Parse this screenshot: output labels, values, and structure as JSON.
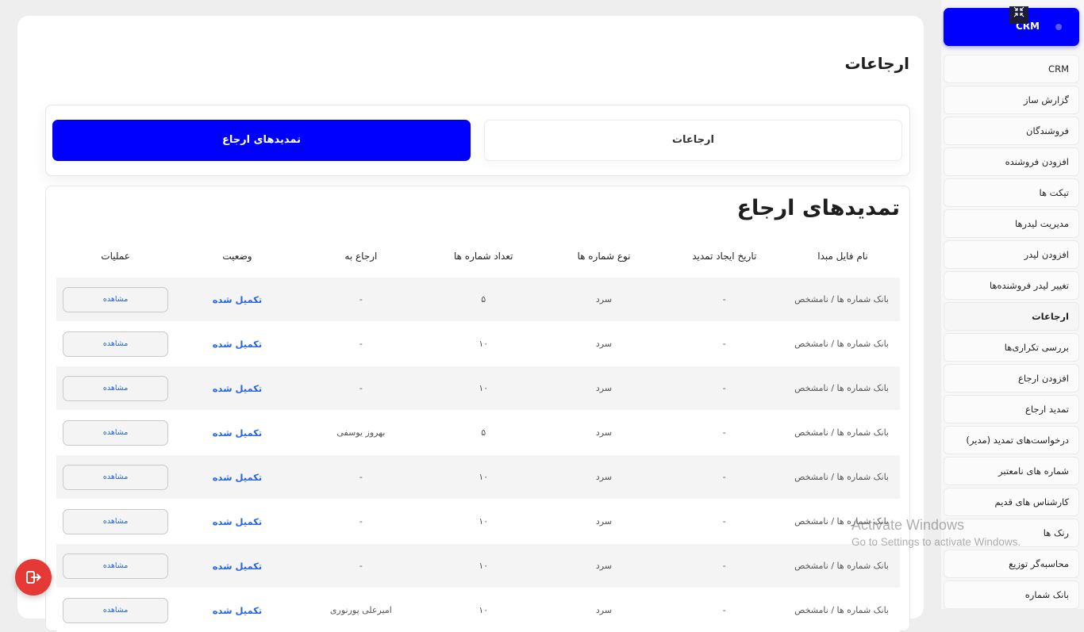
{
  "sidebar": {
    "header_label": "CRM",
    "items": [
      {
        "label": "CRM",
        "active": false
      },
      {
        "label": "گزارش ساز",
        "active": false
      },
      {
        "label": "فروشندگان",
        "active": false
      },
      {
        "label": "افزودن فروشنده",
        "active": false
      },
      {
        "label": "تیکت ها",
        "active": false
      },
      {
        "label": "مدیریت لیدرها",
        "active": false
      },
      {
        "label": "افزودن لیدر",
        "active": false
      },
      {
        "label": "تغییر لیدر فروشنده‌ها",
        "active": false
      },
      {
        "label": "ارجاعات",
        "active": true
      },
      {
        "label": "بررسی تکراری‌ها",
        "active": false
      },
      {
        "label": "افزودن ارجاع",
        "active": false
      },
      {
        "label": "تمدید ارجاع",
        "active": false
      },
      {
        "label": "درخواست‌های تمدید (مدیر)",
        "active": false
      },
      {
        "label": "شماره های نامعتبر",
        "active": false
      },
      {
        "label": "کارشناس های قدیم",
        "active": false
      },
      {
        "label": "رنک ها",
        "active": false
      },
      {
        "label": "محاسبه‌گر توزیع",
        "active": false
      },
      {
        "label": "بانک شماره",
        "active": false
      }
    ]
  },
  "page": {
    "title": "ارجاعات",
    "tabs": {
      "referrals": "ارجاعات",
      "extensions": "تمدیدهای ارجاع"
    },
    "section_title": "تمدیدهای ارجاع"
  },
  "table": {
    "headers": [
      "نام فایل مبدا",
      "تاریخ ایجاد تمدید",
      "نوع شماره ها",
      "تعداد شماره ها",
      "ارجاع به",
      "وضعیت",
      "عملیات"
    ],
    "rows": [
      {
        "file": "بانک شماره ها / نامشخص",
        "date": "-",
        "type": "سرد",
        "count": "۵",
        "referred_to": "-",
        "status": "تکمیل شده",
        "action": "مشاهده"
      },
      {
        "file": "بانک شماره ها / نامشخص",
        "date": "-",
        "type": "سرد",
        "count": "۱۰",
        "referred_to": "-",
        "status": "تکمیل شده",
        "action": "مشاهده"
      },
      {
        "file": "بانک شماره ها / نامشخص",
        "date": "-",
        "type": "سرد",
        "count": "۱۰",
        "referred_to": "-",
        "status": "تکمیل شده",
        "action": "مشاهده"
      },
      {
        "file": "بانک شماره ها / نامشخص",
        "date": "-",
        "type": "سرد",
        "count": "۵",
        "referred_to": "بهروز یوسفی",
        "status": "تکمیل شده",
        "action": "مشاهده"
      },
      {
        "file": "بانک شماره ها / نامشخص",
        "date": "-",
        "type": "سرد",
        "count": "۱۰",
        "referred_to": "-",
        "status": "تکمیل شده",
        "action": "مشاهده"
      },
      {
        "file": "بانک شماره ها / نامشخص",
        "date": "-",
        "type": "سرد",
        "count": "۱۰",
        "referred_to": "-",
        "status": "تکمیل شده",
        "action": "مشاهده"
      },
      {
        "file": "بانک شماره ها / نامشخص",
        "date": "-",
        "type": "سرد",
        "count": "۱۰",
        "referred_to": "-",
        "status": "تکمیل شده",
        "action": "مشاهده"
      },
      {
        "file": "بانک شماره ها / نامشخص",
        "date": "-",
        "type": "سرد",
        "count": "۱۰",
        "referred_to": "امیرعلی پورنوری",
        "status": "تکمیل شده",
        "action": "مشاهده"
      }
    ]
  },
  "icons": {
    "collapse": "collapse-arrows-icon",
    "logout": "logout-icon"
  },
  "watermark": {
    "line1": "Activate Windows",
    "line2": "Go to Settings to activate Windows."
  },
  "colors": {
    "accent": "#0000ff",
    "status": "#2563eb",
    "logout": "#e53935"
  }
}
